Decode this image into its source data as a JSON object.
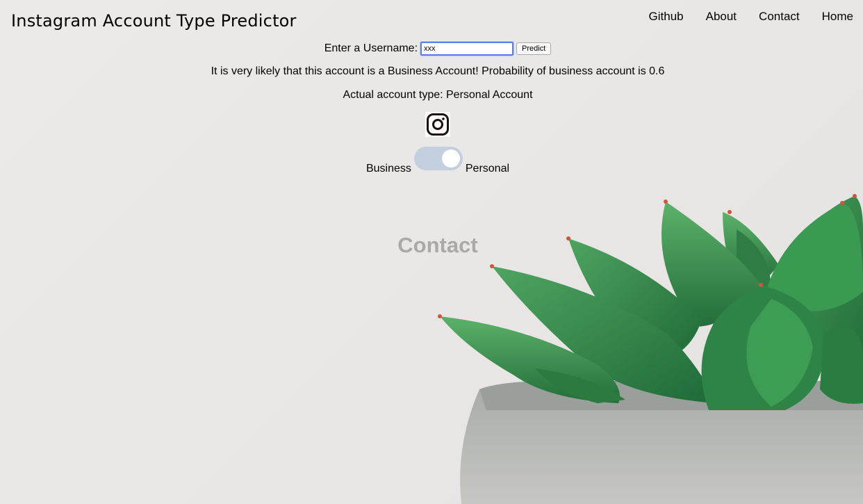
{
  "header": {
    "title": "Instagram Account Type Predictor"
  },
  "nav": {
    "items": [
      "Github",
      "About",
      "Contact",
      "Home"
    ]
  },
  "form": {
    "label": "Enter a Username:",
    "username_value": "xxx",
    "predict_label": "Predict"
  },
  "result": {
    "prediction_text": "It is very likely that this account is a Business Account! Probability of business account is 0.6",
    "actual_text": "Actual account type: Personal Account"
  },
  "toggle": {
    "left_label": "Business",
    "right_label": "Personal",
    "selected": "Personal"
  },
  "contact": {
    "heading": "Contact"
  },
  "icons": {
    "instagram": "instagram-icon"
  },
  "colors": {
    "input_focus": "#5b7cf0",
    "toggle_track": "#c3cede",
    "contact_heading": "#a9a9a9"
  }
}
